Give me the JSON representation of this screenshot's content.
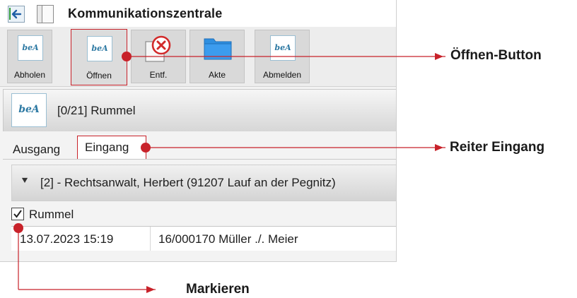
{
  "window": {
    "title": "Kommunikationszentrale"
  },
  "toolbar": {
    "buttons": [
      {
        "label": "Abholen",
        "icon": "bea-icon"
      },
      {
        "label": "Öffnen",
        "icon": "bea-icon"
      },
      {
        "label": "Entf.",
        "icon": "delete-icon"
      },
      {
        "label": "Akte",
        "icon": "folder-icon"
      },
      {
        "label": "Abmelden",
        "icon": "bea-icon"
      }
    ],
    "bea_logo_text": "beA"
  },
  "mailbox": {
    "title": "[0/21] Rummel"
  },
  "tabs": {
    "outgoing": "Ausgang",
    "incoming": "Eingang"
  },
  "group": {
    "title": "[2] - Rechtsanwalt, Herbert (91207 Lauf an der Pegnitz)"
  },
  "selection": {
    "label": "Rummel",
    "checked": true
  },
  "messages": [
    {
      "date": "13.07.2023 15:19",
      "subject": "16/000170 Müller ./. Meier"
    }
  ],
  "annotations": {
    "open_button": "Öffnen-Button",
    "tab_incoming": "Reiter Eingang",
    "select": "Markieren"
  },
  "colors": {
    "accent_red": "#c8222a",
    "bea_blue": "#2d79a3",
    "folder_blue": "#2f8fe0"
  }
}
